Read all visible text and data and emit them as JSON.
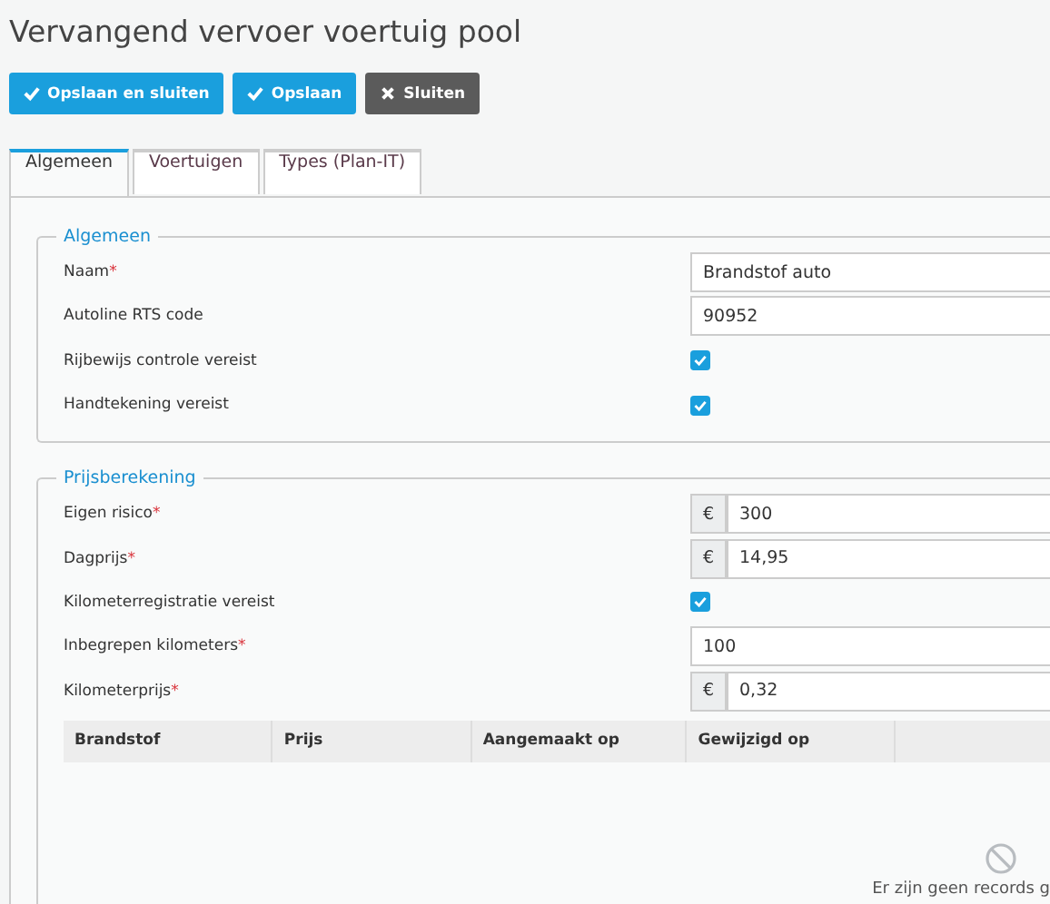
{
  "title": "Vervangend vervoer voertuig pool",
  "buttons": [
    {
      "label": "Opslaan en sluiten",
      "kind": "primary"
    },
    {
      "label": "Opslaan",
      "kind": "primary"
    },
    {
      "label": "Sluiten",
      "kind": "dark"
    }
  ],
  "tabs": [
    {
      "label": "Algemeen",
      "selected": true
    },
    {
      "label": "Voertuigen",
      "selected": false
    },
    {
      "label": "Types (Plan-IT)",
      "selected": false
    }
  ],
  "sections": [
    {
      "legend": "Algemeen",
      "fields": [
        {
          "label": "Naam",
          "required_mark": "*",
          "kind": "text",
          "value": "Brandstof auto"
        },
        {
          "label": "Autoline RTS code",
          "kind": "text",
          "value": "90952"
        },
        {
          "label": "Rijbewijs controle vereist",
          "kind": "checkbox",
          "checked": true
        },
        {
          "label": "Handtekening vereist",
          "kind": "checkbox",
          "checked": true
        }
      ]
    },
    {
      "legend": "Prijsberekening",
      "fields": [
        {
          "label": "Eigen risico",
          "required_mark": "*",
          "kind": "currency",
          "prefix": "€",
          "value": "300"
        },
        {
          "label": "Dagprijs",
          "required_mark": "*",
          "kind": "currency",
          "prefix": "€",
          "value": "14,95"
        },
        {
          "label": "Kilometerregistratie vereist",
          "kind": "checkbox",
          "checked": true
        },
        {
          "label": "Inbegrepen kilometers",
          "required_mark": "*",
          "kind": "text",
          "value": "100"
        },
        {
          "label": "Kilometerprijs",
          "required_mark": "*",
          "kind": "currency",
          "prefix": "€",
          "value": "0,32"
        }
      ],
      "table": {
        "columns": [
          "Brandstof",
          "Prijs",
          "Aangemaakt op",
          "Gewijzigd op"
        ],
        "empty_message": "Er zijn geen records g"
      }
    }
  ]
}
